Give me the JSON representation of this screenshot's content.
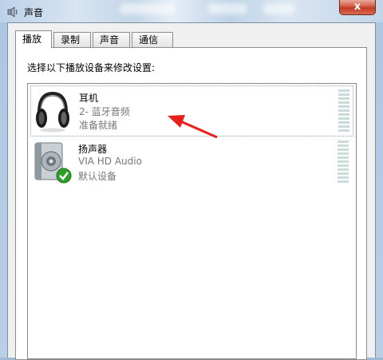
{
  "window": {
    "title": "声音",
    "close_label": "x"
  },
  "tabs": [
    {
      "label": "播放",
      "active": true
    },
    {
      "label": "录制",
      "active": false
    },
    {
      "label": "声音",
      "active": false
    },
    {
      "label": "通信",
      "active": false
    }
  ],
  "panel": {
    "instruction": "选择以下播放设备来修改设置:"
  },
  "devices": [
    {
      "name": "耳机",
      "description": "2- 蓝牙音频",
      "status": "准备就绪",
      "icon": "headphones-icon",
      "selected": true
    },
    {
      "name": "扬声器",
      "description": "VIA HD Audio",
      "status": "默认设备",
      "icon": "speaker-icon",
      "default": true
    }
  ],
  "colors": {
    "annotation_arrow": "#e8201c",
    "default_check": "#2fa12a",
    "close_button": "#c7432c"
  }
}
